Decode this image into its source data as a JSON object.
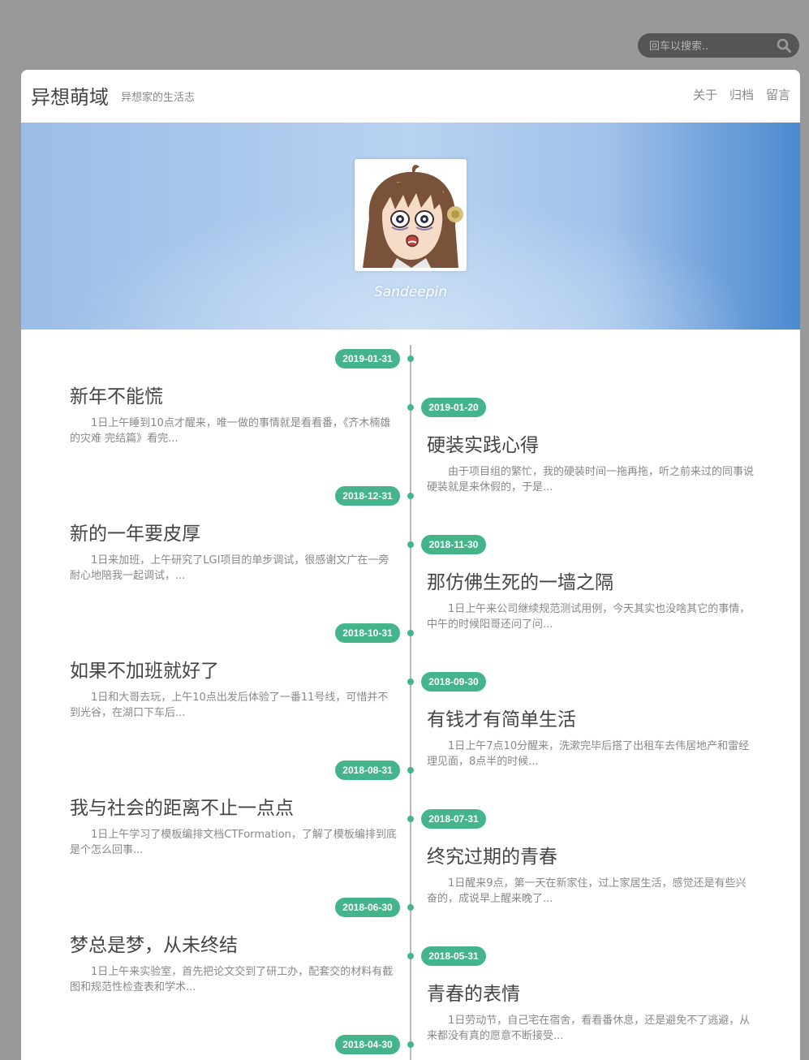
{
  "search": {
    "placeholder": "回车以搜索.."
  },
  "header": {
    "title": "异想萌域",
    "subtitle": "异想家的生活志",
    "nav": [
      "关于",
      "归档",
      "留言"
    ]
  },
  "banner": {
    "author": "Sandeepin"
  },
  "posts": [
    {
      "date": "2019-01-31",
      "title": "新年不能慌",
      "excerpt": "1日上午睡到10点才醒来，唯一做的事情就是看看番，《齐木楠雄的灾难 完结篇》看完..."
    },
    {
      "date": "2019-01-20",
      "title": "硬装实践心得",
      "excerpt": "由于项目组的繁忙，我的硬装时间一拖再拖，听之前来过的同事说硬装就是来休假的，于是..."
    },
    {
      "date": "2018-12-31",
      "title": "新的一年要皮厚",
      "excerpt": "1日来加班，上午研究了LGI项目的单步调试，很感谢文广在一旁耐心地陪我一起调试，..."
    },
    {
      "date": "2018-11-30",
      "title": "那仿佛生死的一墙之隔",
      "excerpt": "1日上午来公司继续规范测试用例，今天其实也没啥其它的事情，中午的时候阳哥还问了问..."
    },
    {
      "date": "2018-10-31",
      "title": "如果不加班就好了",
      "excerpt": "1日和大哥去玩，上午10点出发后体验了一番11号线，可惜并不到光谷，在湖口下车后..."
    },
    {
      "date": "2018-09-30",
      "title": "有钱才有简单生活",
      "excerpt": "1日上午7点10分醒来，洗漱完毕后搭了出租车去伟居地产和雷经理见面，8点半的时候..."
    },
    {
      "date": "2018-08-31",
      "title": "我与社会的距离不止一点点",
      "excerpt": "1日上午学习了模板编排文档CTFormation，了解了模板编排到底是个怎么回事..."
    },
    {
      "date": "2018-07-31",
      "title": "终究过期的青春",
      "excerpt": "1日醒来9点，第一天在新家住，过上家居生活，感觉还是有些兴奋的，成说早上醒来晚了..."
    },
    {
      "date": "2018-06-30",
      "title": "梦总是梦，从未终结",
      "excerpt": "1日上午来实验室，首先把论文交到了研工办，配套交的材料有截图和规范性检查表和学术..."
    },
    {
      "date": "2018-05-31",
      "title": "青春的表情",
      "excerpt": "1日劳动节，自己宅在宿舍，看看番休息，还是避免不了逃避，从来都没有真的愿意不断接受..."
    },
    {
      "date": "2018-04-30",
      "title": "",
      "excerpt": ""
    }
  ]
}
